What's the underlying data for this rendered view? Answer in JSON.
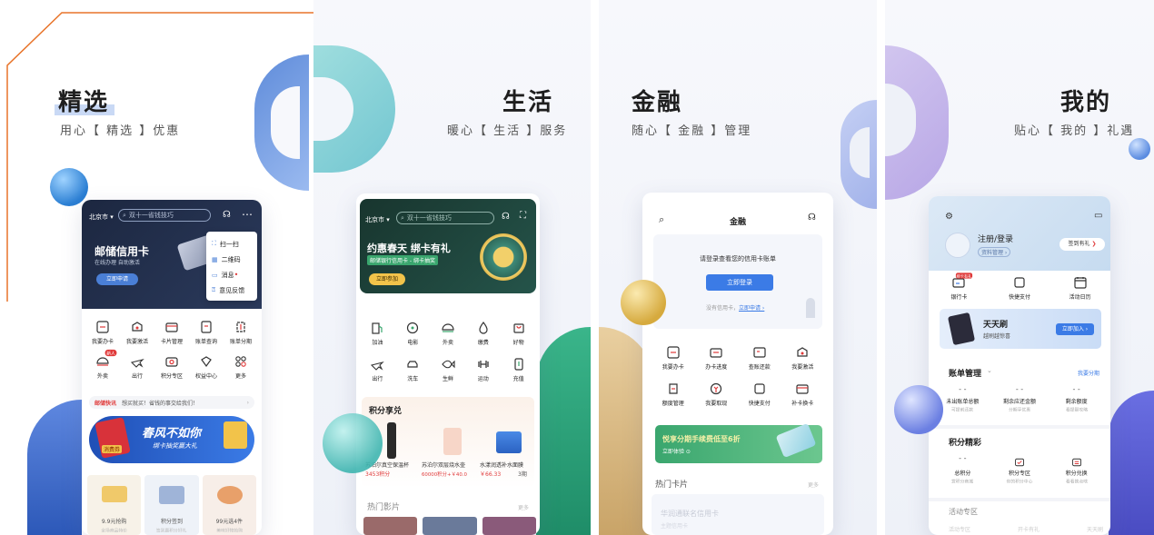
{
  "panel1": {
    "title": "精选",
    "subtitle": "用心【 精选 】优惠",
    "city": "北京市 ▾",
    "search_placeholder": "双十一省钱技巧",
    "banner_title": "邮储信用卡",
    "banner_sub": "在线办理 自助激活",
    "banner_btn": "立即申请",
    "popup": [
      "扫一扫",
      "二维码",
      "消息",
      "意见反馈"
    ],
    "grid": [
      "我要办卡",
      "我要激活",
      "卡片管理",
      "账单查询",
      "账单分期",
      "外卖",
      "出行",
      "积分专区",
      "权益中心",
      "更多"
    ],
    "news_tag": "邮储快讯",
    "news_text": "想买就买！省钱的事交给我们！",
    "promo_title": "春风不如你",
    "promo_sub": "绑卡抽奖赢大礼",
    "promo_badge": "消费券",
    "cards": [
      {
        "title": "9.9元抢购",
        "sub": "全场商品特价"
      },
      {
        "title": "积分签到",
        "sub": "签到赢积分好礼"
      },
      {
        "title": "99元选4件",
        "sub": "美味好物抢购"
      }
    ],
    "grid_badge": "新人"
  },
  "panel2": {
    "title": "生活",
    "subtitle": "暖心【 生活 】服务",
    "city": "北京市 ▾",
    "search_placeholder": "双十一省钱技巧",
    "banner_title": "约惠春天 绑卡有礼",
    "banner_sub": "邮储银行信用卡 - 绑卡抽奖",
    "banner_btn": "立即参加",
    "grid": [
      "加油",
      "电影",
      "外卖",
      "缴费",
      "好物",
      "出行",
      "洗车",
      "生鲜",
      "运动",
      "充值"
    ],
    "points_title": "积分享兑",
    "products": [
      {
        "name": "苏泊尔真空保温杯",
        "price": "3453积分"
      },
      {
        "name": "苏泊尔双层烧水壶",
        "price": "60000积分+￥40.0"
      },
      {
        "name": "水漾润透补水面膜",
        "price": "￥66.33",
        "extra": "3期"
      }
    ],
    "movies_title": "热门影片",
    "movies_more": "更多"
  },
  "panel3": {
    "title": "金融",
    "subtitle": "随心【 金融 】管理",
    "page_title": "金融",
    "login_hint": "请登录查看您的信用卡账单",
    "login_btn": "立即登录",
    "no_card": "没有信用卡，",
    "apply_link": "立即申请 ›",
    "grid": [
      "我要办卡",
      "办卡进度",
      "查账还款",
      "我要激活",
      "额度管理",
      "我要取现",
      "快捷支付",
      "补卡换卡"
    ],
    "banner_title": "悦享分期手续费低至6折",
    "banner_sub": "立即体验 ⊙",
    "hot_title": "热门卡片",
    "hot_more": "更多",
    "card_title": "华润通联名信用卡",
    "card_sub": "主题信用卡"
  },
  "panel4": {
    "title": "我的",
    "subtitle": "贴心【 我的 】礼遇",
    "login": "注册/登录",
    "profile_btn": "资料管理 ›",
    "signin_btn": "签到有礼",
    "quick": [
      {
        "label": "银行卡",
        "badge": "绑卡有礼"
      },
      {
        "label": "快捷支付"
      },
      {
        "label": "活动日历"
      }
    ],
    "banner_title": "天天刷",
    "banner_sub": "越刷越惊喜",
    "banner_btn": "立即加入 ›",
    "bill_title": "账单管理",
    "bill_more": "我要分期",
    "bill_items": [
      {
        "value": "- -",
        "label": "未出账单总额",
        "sub": "可提前还款"
      },
      {
        "value": "- -",
        "label": "剩余应还金额",
        "sub": "分期享优惠"
      },
      {
        "value": "- -",
        "label": "剩余额度",
        "sub": "看提额攻略"
      }
    ],
    "points_title": "积分精彩",
    "points_items": [
      {
        "value": "- -",
        "label": "总积分",
        "sub": "赏积分商城"
      },
      {
        "label": "积分专区",
        "sub": "你的积分中心"
      },
      {
        "label": "积分兑换",
        "sub": "看看换点啥"
      }
    ],
    "activity_title": "活动专区",
    "activity_items": [
      "活动专区",
      "开卡有礼",
      "天天刷"
    ]
  },
  "colors": {
    "accent": "#e8742a",
    "green": "#3aa66e",
    "blue": "#3b7be6",
    "navy": "#1e2a44"
  }
}
